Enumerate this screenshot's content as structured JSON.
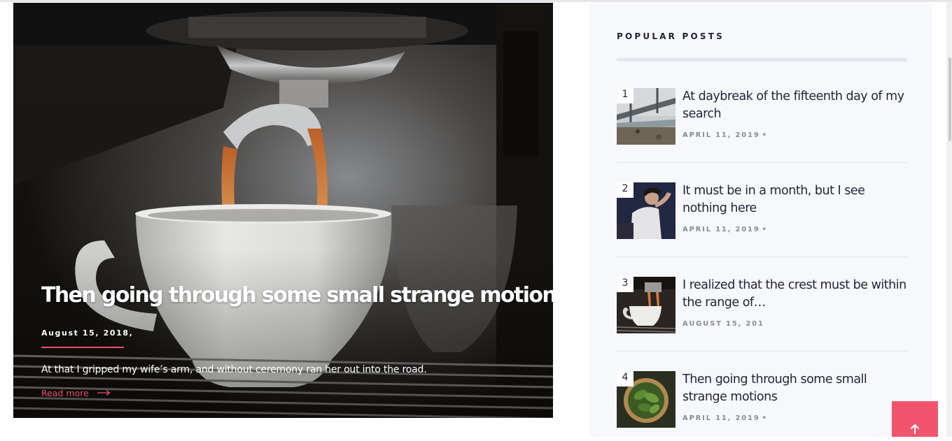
{
  "featured": {
    "title": "Then going through some small strange motions",
    "date": "August 15, 2018,",
    "excerpt": "At that I gripped my wife’s arm, and without ceremony ran her out into the road.",
    "read_more": "Read more",
    "read_more_icon": "arrow-right-icon",
    "image": "espresso-machine-pouring-coffee-into-white-cup",
    "accent_color": "#f0506e"
  },
  "sidebar": {
    "widget_title": "POPULAR POSTS",
    "posts": [
      {
        "number": "1",
        "title": "At daybreak of the fifteenth day of my search",
        "date": "APRIL 11, 2019",
        "separator": "•",
        "thumbnail": "bridge-over-river"
      },
      {
        "number": "2",
        "title": "It must be in a month, but I see nothing here",
        "date": "APRIL 11, 2019",
        "separator": "•",
        "thumbnail": "man-lying-on-floor"
      },
      {
        "number": "3",
        "title": "I realized that the crest must be within the range of…",
        "date": "AUGUST 15, 201",
        "separator": "",
        "thumbnail": "espresso-cup"
      },
      {
        "number": "4",
        "title": "Then going through some small strange motions",
        "date": "APRIL 11, 2019",
        "separator": "•",
        "thumbnail": "basil-leaves-bowl"
      }
    ]
  },
  "back_to_top": {
    "icon": "arrow-up-icon",
    "color": "#f1556e"
  }
}
